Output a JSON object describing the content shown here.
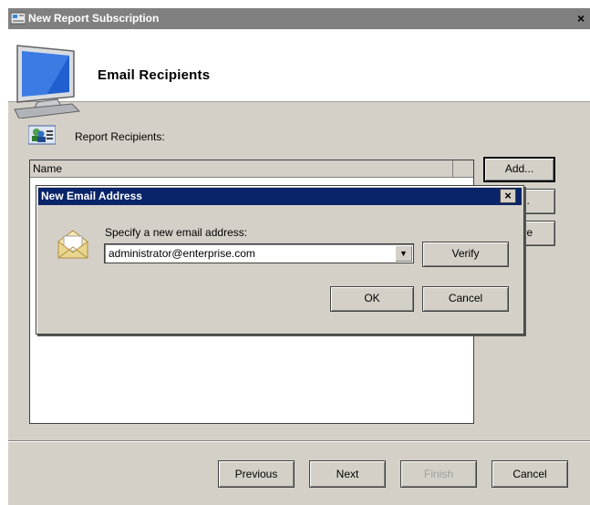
{
  "window": {
    "title": "New Report Subscription",
    "close_glyph": "×"
  },
  "header": {
    "title": "Email Recipients"
  },
  "recipients": {
    "label": "Report Recipients:",
    "column_name": "Name"
  },
  "side_buttons": {
    "add": "Add...",
    "edit": "dit...",
    "remove": "move"
  },
  "footer": {
    "previous": "Previous",
    "next": "Next",
    "finish": "Finish",
    "cancel": "Cancel"
  },
  "dialog": {
    "title": "New Email Address",
    "close_glyph": "×",
    "prompt": "Specify a new email address:",
    "email_value": "administrator@enterprise.com",
    "verify": "Verify",
    "ok": "OK",
    "cancel": "Cancel"
  },
  "colors": {
    "dialog_title_bg": "#0a246a",
    "window_bg": "#d4d0c8",
    "inactive_title_bg": "#808080"
  },
  "icons": [
    "window-icon",
    "monitor-icon",
    "recipients-icon",
    "envelope-icon",
    "dropdown-arrow-icon"
  ]
}
